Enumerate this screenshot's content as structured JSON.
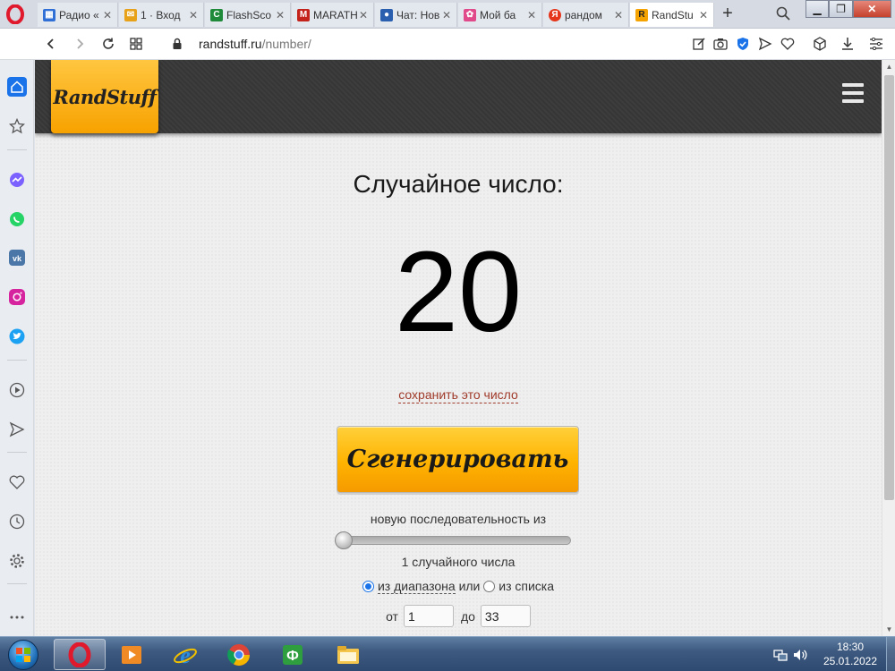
{
  "browser": {
    "tabs": [
      {
        "label": "Радио «",
        "color": "#2f6fd6",
        "glyph": "▦"
      },
      {
        "label": "1 · Вход",
        "color": "#e8a21a",
        "glyph": "✉"
      },
      {
        "label": "FlashSco",
        "color": "#1e8a3a",
        "glyph": "C"
      },
      {
        "label": "MARATH",
        "color": "#c4231b",
        "glyph": "M"
      },
      {
        "label": "Чат: Нов",
        "color": "#2a5fb0",
        "glyph": "●"
      },
      {
        "label": "Мой ба",
        "color": "#e04a8a",
        "glyph": "✿"
      },
      {
        "label": "рандом",
        "color": "#e5361b",
        "glyph": "Я"
      },
      {
        "label": "RandStu",
        "color": "#f5a300",
        "glyph": "R"
      }
    ],
    "new_tab": "+",
    "url_host": "randstuff.ru",
    "url_path": "/number/"
  },
  "page": {
    "logo": "RandStuff",
    "title": "Случайное число:",
    "number": "20",
    "save_link": "сохранить это число",
    "generate_button": "Сгенерировать",
    "sequence_label": "новую последовательность из",
    "slider_value": 1,
    "count_label": "1 случайного числа",
    "mode_range": "из диапазона",
    "mode_or": "или",
    "mode_list": "из списка",
    "from_label": "от",
    "from_value": "1",
    "to_label": "до",
    "to_value": "33"
  },
  "taskbar": {
    "time": "18:30",
    "date": "25.01.2022"
  },
  "colors": {
    "accent": "#ffb300",
    "header_dark": "#3a3a3a",
    "link": "#a03a2a"
  }
}
